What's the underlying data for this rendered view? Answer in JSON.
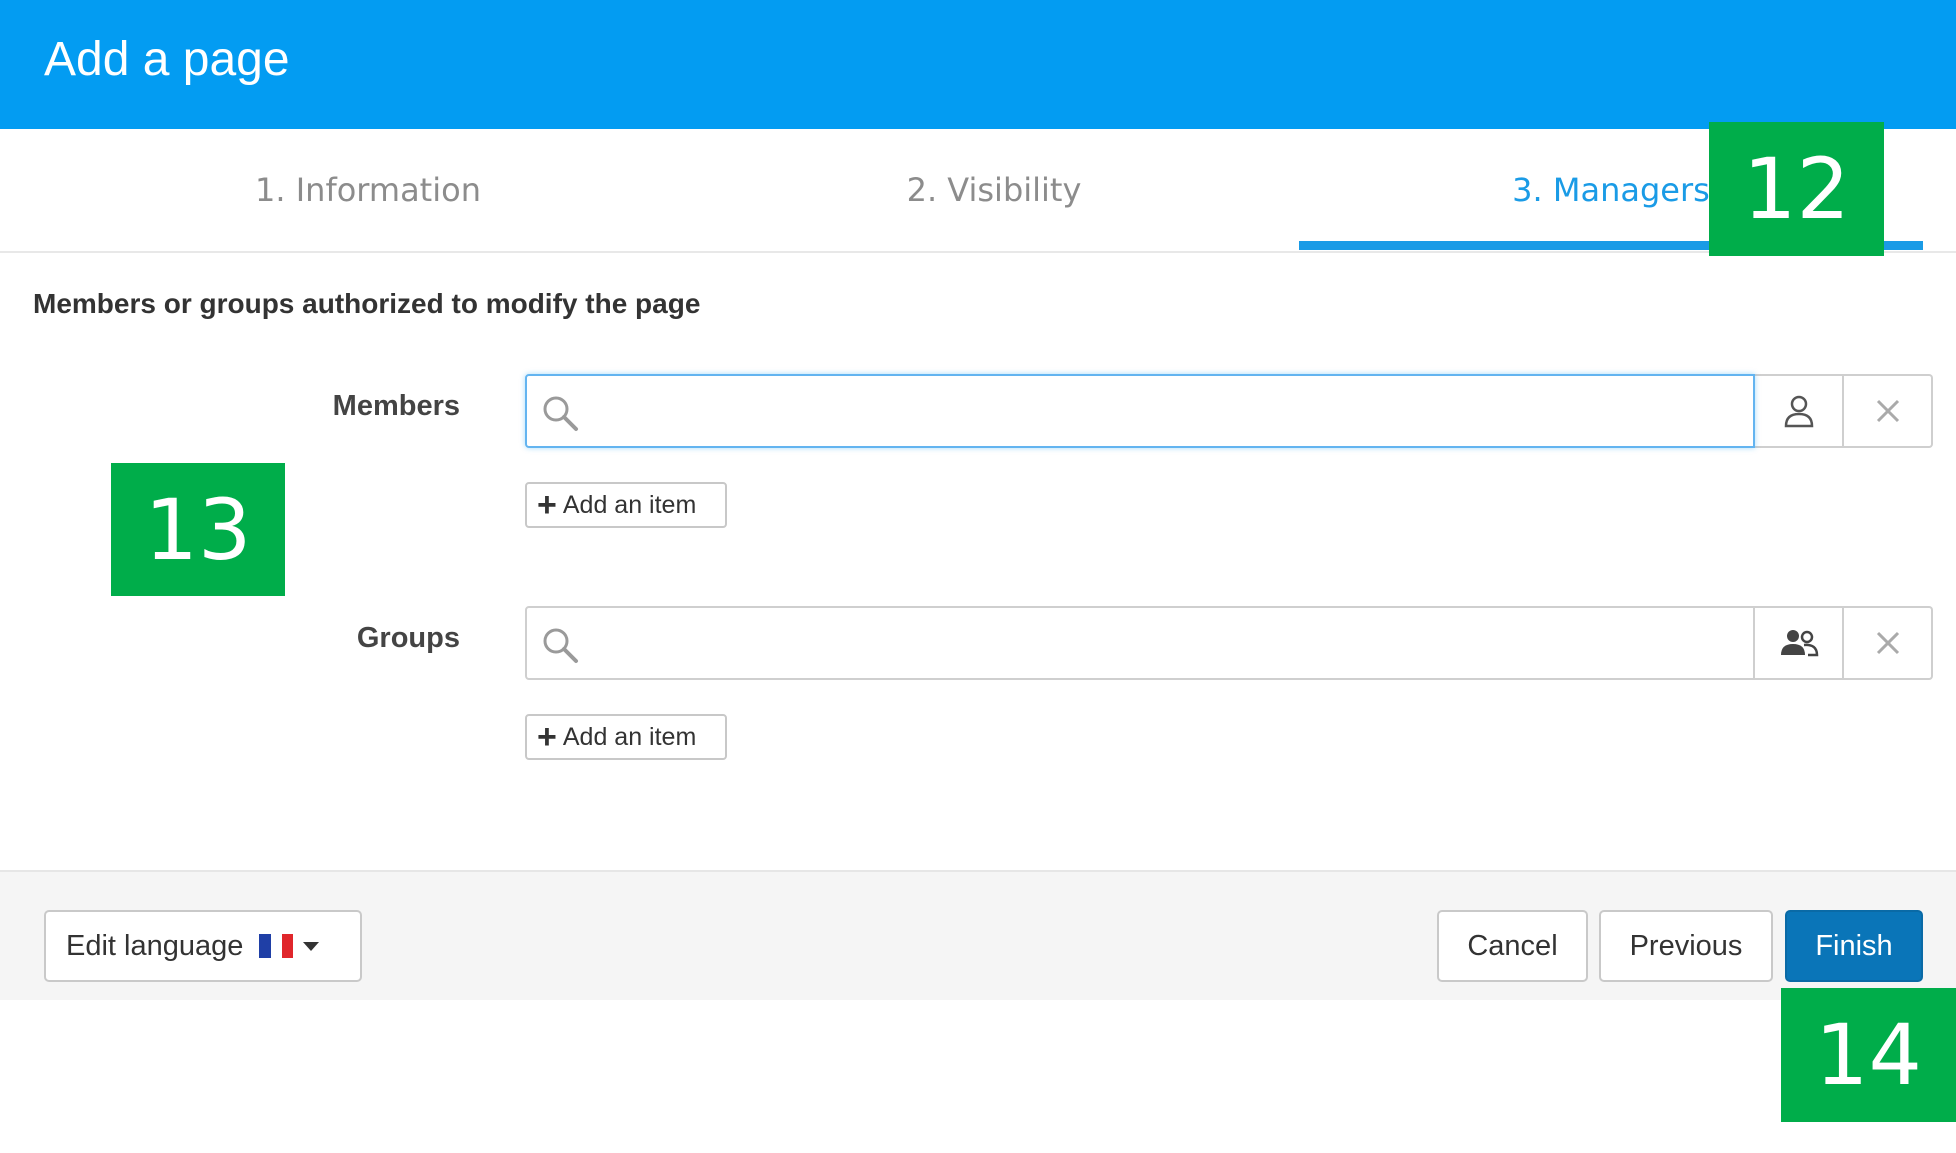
{
  "header": {
    "title": "Add a page"
  },
  "tabs": [
    {
      "label": "1. Information",
      "active": false
    },
    {
      "label": "2. Visibility",
      "active": false
    },
    {
      "label": "3. Managers",
      "active": true
    }
  ],
  "section": {
    "title": "Members or groups authorized to modify the page"
  },
  "members": {
    "label": "Members",
    "search_value": "",
    "addon_icon": "user-icon",
    "clear_icon": "close-icon",
    "add_item_label": "Add an item"
  },
  "groups": {
    "label": "Groups",
    "search_value": "",
    "addon_icon": "group-icon",
    "clear_icon": "close-icon",
    "add_item_label": "Add an item"
  },
  "footer": {
    "edit_language_label": "Edit language",
    "language_flag": "fr-flag-icon",
    "cancel_label": "Cancel",
    "previous_label": "Previous",
    "finish_label": "Finish"
  },
  "badges": [
    "12",
    "13",
    "14"
  ],
  "colors": {
    "header_bg": "#039cf2",
    "active_tab": "#1a9be6",
    "finish_bg": "#0a75b8",
    "badge_bg": "#00ad4a"
  }
}
